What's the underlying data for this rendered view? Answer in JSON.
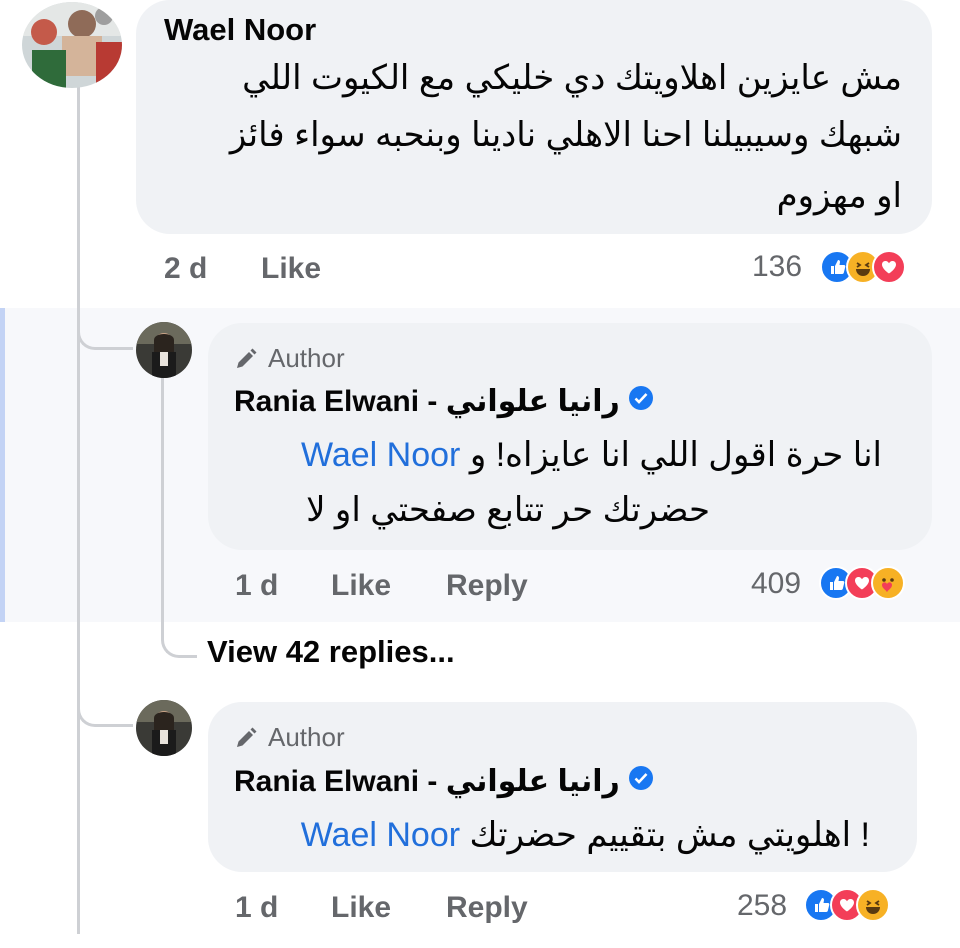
{
  "comment": {
    "author": "Wael Noor",
    "lines": [
      "مش عايزين اهلاويتك دي خليكي مع الكيوت اللي",
      "شبهك وسيبيلنا احنا الاهلي نادينا وبنحبه سواء فائز",
      "او مهزوم"
    ],
    "time": "2 d",
    "like_label": "Like",
    "reaction_count": "136",
    "reactions": [
      "like-icon",
      "haha-icon",
      "love-icon"
    ]
  },
  "reply1": {
    "badge": "Author",
    "author": "Rania Elwani - رانيا علواني",
    "line1_text": "انا حرة اقول اللي انا عايزاه! و",
    "line1_mention": "Wael Noor",
    "line2": "حضرتك حر تتابع صفحتي او لا",
    "time": "1 d",
    "like_label": "Like",
    "reply_label": "Reply",
    "reaction_count": "409",
    "reactions": [
      "like-icon",
      "love-icon",
      "care-icon"
    ]
  },
  "view_replies": "View 42 replies...",
  "reply2": {
    "badge": "Author",
    "author": "Rania Elwani - رانيا علواني",
    "line1_text": "! اهلويتي مش بتقييم حضرتك",
    "line1_mention": "Wael Noor",
    "time": "1 d",
    "like_label": "Like",
    "reply_label": "Reply",
    "reaction_count": "258",
    "reactions": [
      "like-icon",
      "love-icon",
      "haha-icon"
    ]
  },
  "colors": {
    "mention": "#216fdb",
    "like": "#1877f2",
    "love": "#f33e58",
    "haha": "#f7b125",
    "bubble": "#f0f2f5",
    "verified": "#1877f2"
  }
}
